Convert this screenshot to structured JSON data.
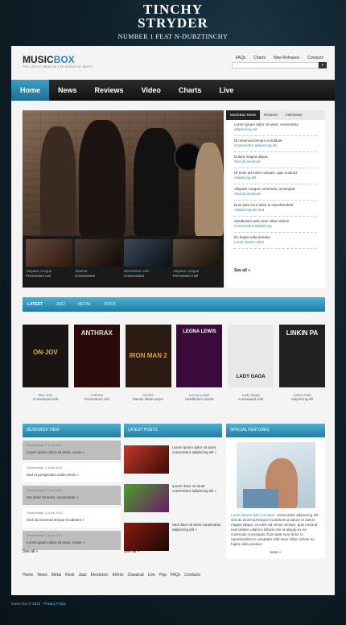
{
  "banner": {
    "line1": "TINCHY",
    "line2": "STRYDER",
    "line3": "NUMBER 1 FEAT N-DUBZTINCHY"
  },
  "header": {
    "logo_a": "MUSIC",
    "logo_b": "BOX",
    "tagline": "THE LATEST NEWS IN THE WORLD OF MUSIC",
    "links": [
      "FAQs",
      "Charts",
      "New Releases",
      "Contacts"
    ],
    "search_button": "»"
  },
  "nav": [
    "Home",
    "News",
    "Reviews",
    "Video",
    "Charts",
    "Live"
  ],
  "hero": {
    "thumbs": [
      {
        "cap": "Aliquam congue",
        "sub": "Fermentum nisl"
      },
      {
        "cap": "Ultamet",
        "sub": "Consectetue"
      },
      {
        "cap": "Elementum nisl",
        "sub": "Consectetue"
      },
      {
        "cap": "Aliquam congue",
        "sub": "Fermentum nisl"
      }
    ]
  },
  "newsbox": {
    "tabs": [
      "MusicBox News",
      "Reviews",
      "Interviews"
    ],
    "items": [
      {
        "t": "Lorem ipsum dolor sit amet, consectetur",
        "s": "adipisicing elit"
      },
      {
        "t": "Do eiusmod tempor incididunt",
        "s": "Consectetur adipisicing elit"
      },
      {
        "t": "Dolore magna aliqua",
        "s": "Sed do eiusmod"
      },
      {
        "t": "Ut enim ad minim veniam, quis nostrud",
        "s": "Adipiscing elit"
      },
      {
        "t": "Aliquam congue commodo consequat",
        "s": "Sed do eiusmod"
      },
      {
        "t": "Duis aute irure dolor in reprehenderit",
        "s": "Adipisicing elit sed"
      },
      {
        "t": "Vestibulum velit esse cillum dolore",
        "s": "Consectetur adipisicing"
      },
      {
        "t": "Eu fugiat nulla pariatur",
        "s": "Lorem ipsum dolor"
      }
    ],
    "see_all": "See all »"
  },
  "strip": [
    "LATEST",
    "JAZZ",
    "METAL",
    "ROCK"
  ],
  "albums": [
    {
      "cover": "ON·JOV",
      "name": "Bon Jovi",
      "sub": "Consequat velit",
      "bg": "#1a1512",
      "fg": "#d9b24a"
    },
    {
      "cover": "ANTHRAX",
      "name": "Anthrax",
      "sub": "Fermentum nisl",
      "bg": "#2a0a0a",
      "fg": "#e0e0e0"
    },
    {
      "cover": "IRON MAN 2",
      "name": "AC/DC",
      "sub": "Mauris ullamcorper",
      "bg": "#2a1a10",
      "fg": "#e8a030"
    },
    {
      "cover": "LEONA LEWIS",
      "name": "Leona Lewis",
      "sub": "Vestibulum iaculis",
      "bg": "#3a0a3a",
      "fg": "#ffffff"
    },
    {
      "cover": "LADY GAGA",
      "name": "Lady Gaga",
      "sub": "Consequat velit",
      "bg": "#e8e8e8",
      "fg": "#111111"
    },
    {
      "cover": "LINKIN PA",
      "name": "Linkin Park",
      "sub": "Adipiscing elit",
      "bg": "#222222",
      "fg": "#ffffff"
    }
  ],
  "view": {
    "title": "MUSICBOX VIEW",
    "items": [
      {
        "d": "Wednesday, 3 June 2011",
        "t": "Lorem ipsum dolor sit amet, conse »"
      },
      {
        "d": "Wednesday, 3 June 2011",
        "t": "Sed ut perspiciatis unde omnis »"
      },
      {
        "d": "Wednesday, 3 June 2011",
        "t": "Set dolor sit amet, consectetur »"
      },
      {
        "d": "Wednesday, 3 June 2011",
        "t": "Sed do eiusmod tempor incididunt »"
      },
      {
        "d": "Wednesday, 3 June 2011",
        "t": "Lorem ipsum dolor sit amet, conse »"
      }
    ],
    "see_all": "See all »"
  },
  "posts": {
    "title": "LATEST POSTS",
    "items": [
      {
        "t": "Lorem ipsum dolor sit amet consectetur adipiscing elit »"
      },
      {
        "t": "Ipsum dolor sit amet consectetur adipiscing elit »"
      },
      {
        "t": "Sed dolor sit amet consectetur adipiscing elit »"
      }
    ],
    "see_all": "See all »"
  },
  "features": {
    "title": "SPECIAL FEATURES",
    "lead": "Lorem ipsum dolor sit amet,",
    "text": "consectetur adipiscing elit, sed do eiusmod tempor incididunt ut labore et dolore magna aliqua. Ut enim ad minim veniam, quis nostrud exercitation ullamco laboris nisi ut aliquip ex ea commodo consequat. Duis aute irure dolor in reprehenderit in voluptate velit esse cillum dolore eu fugiat nulla pariatur.",
    "more": "more »"
  },
  "footer_nav": [
    "Home",
    "News",
    "Metal",
    "Rock",
    "Jazz",
    "Electronic",
    "Ethnic",
    "Classical",
    "Live",
    "Pop",
    "FAQs",
    "Contacts"
  ],
  "footer": {
    "copy": "music box © 2012 ·",
    "privacy": "Privacy Policy"
  }
}
